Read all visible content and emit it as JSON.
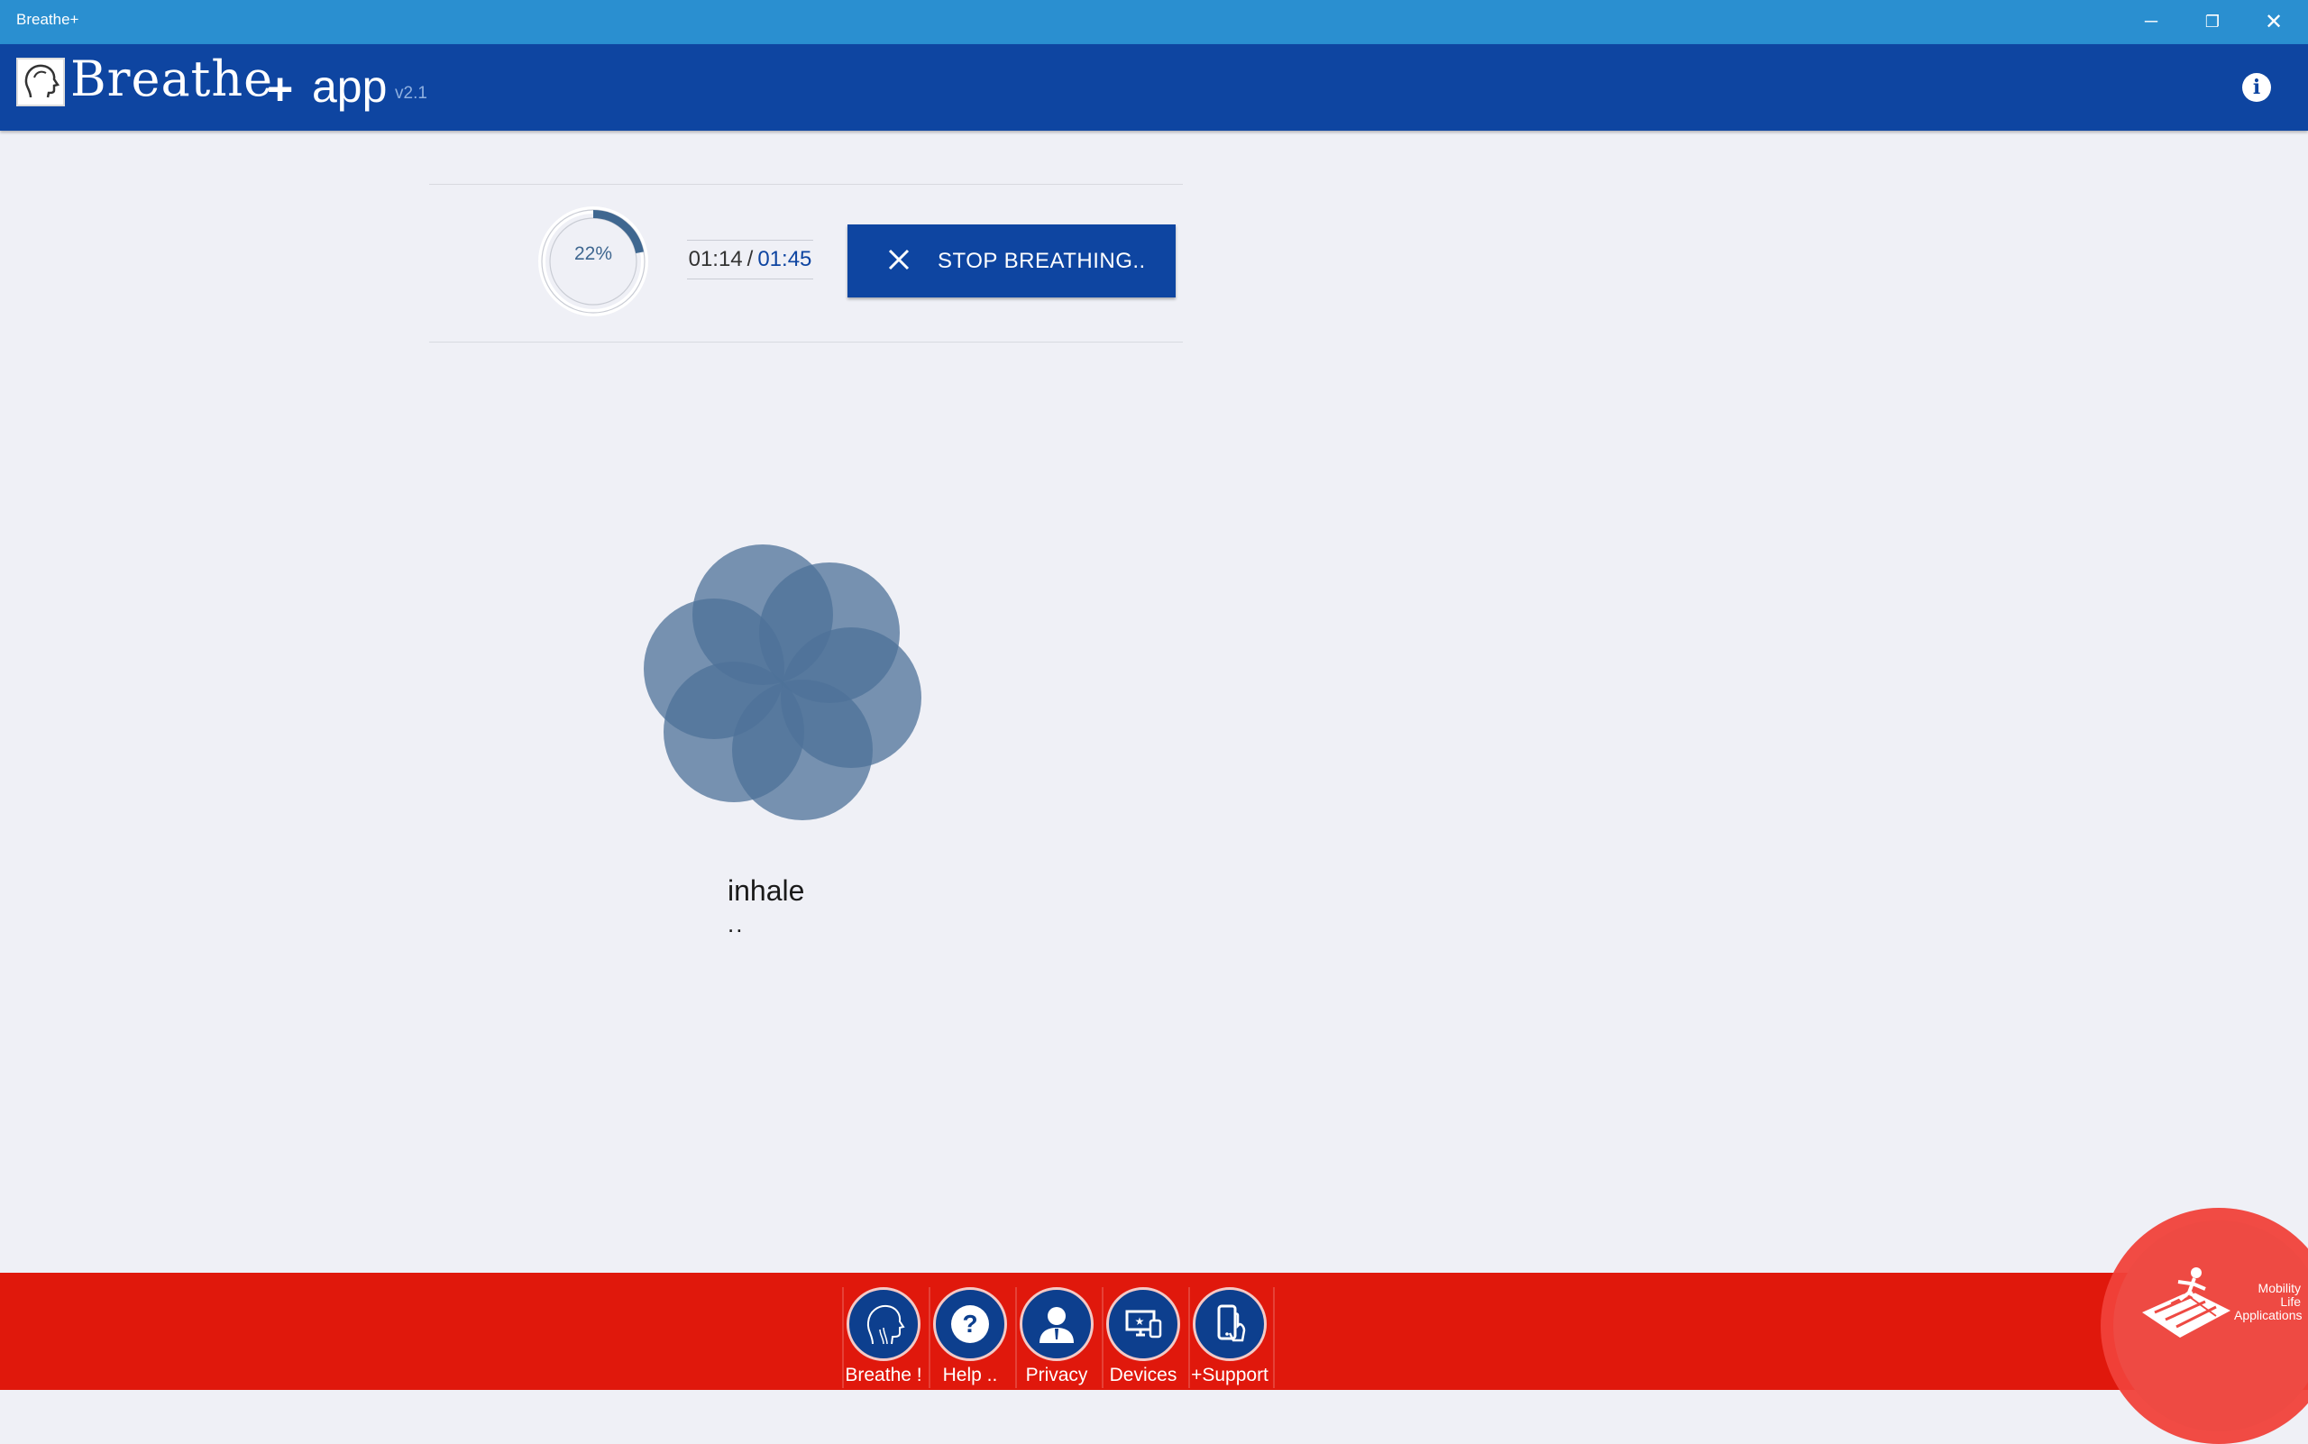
{
  "window": {
    "title": "Breathe+",
    "minimize_glyph": "─",
    "maximize_glyph": "❐",
    "close_glyph": "✕"
  },
  "header": {
    "logo_word": "Breathe",
    "logo_plus": "+",
    "logo_app": "app",
    "version": "v2.1",
    "info_glyph": "i"
  },
  "session": {
    "progress_percent": 22,
    "progress_label": "22%",
    "elapsed": "01:14",
    "separator": "/",
    "total": "01:45",
    "stop_label": "STOP BREATHING..",
    "stop_icon": "close-icon"
  },
  "breathing": {
    "phase": "inhale",
    "dots": ".."
  },
  "bottom_nav": [
    {
      "label": "Breathe !",
      "icon": "head-profile-icon"
    },
    {
      "label": "Help ..",
      "icon": "question-icon"
    },
    {
      "label": "Privacy",
      "icon": "person-icon"
    },
    {
      "label": "Devices",
      "icon": "devices-icon"
    },
    {
      "label": "+Support",
      "icon": "phone-touch-icon"
    }
  ],
  "badge": {
    "lines": [
      "Mobility",
      "Life",
      "Applications"
    ]
  },
  "colors": {
    "titlebar": "#2a8fd0",
    "appbar": "#0e45a1",
    "footer": "#e0180c",
    "flower": "#4d7198",
    "background": "#eff0f6"
  }
}
